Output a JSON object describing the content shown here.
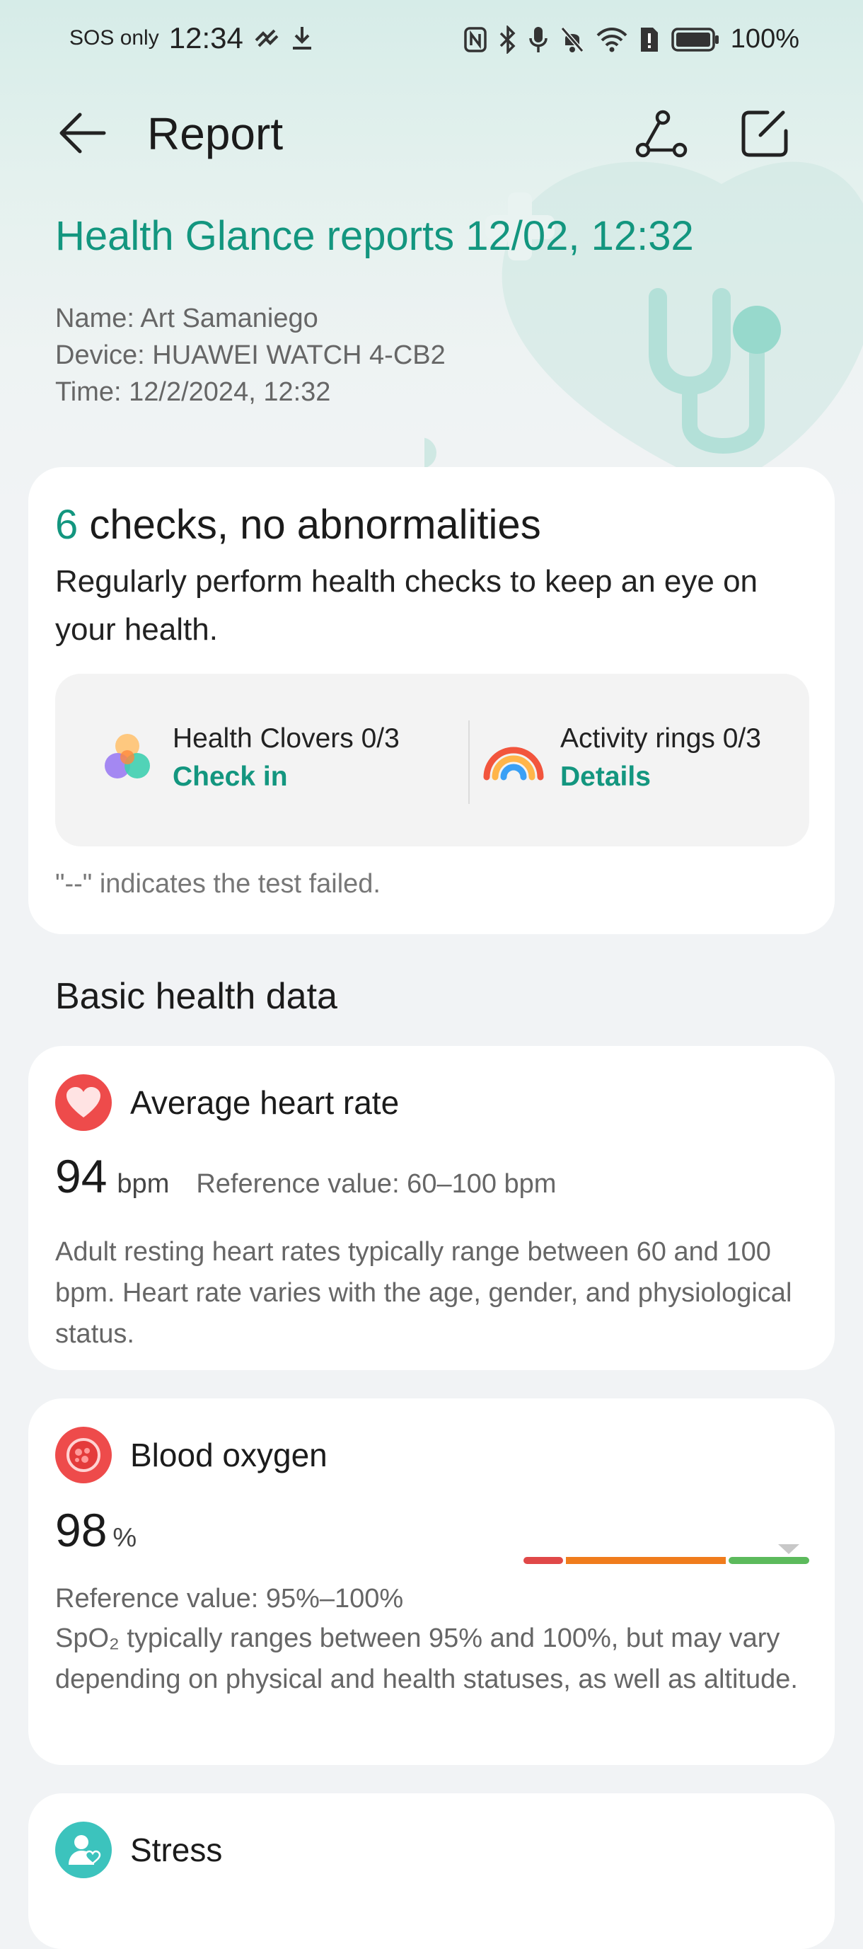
{
  "status_bar": {
    "carrier": "SOS only",
    "time": "12:34",
    "battery": "100%"
  },
  "header": {
    "title": "Report"
  },
  "report": {
    "title": "Health Glance reports 12/02, 12:32",
    "name_line": "Name: Art Samaniego",
    "device_line": "Device: HUAWEI WATCH 4-CB2",
    "time_line": "Time: 12/2/2024, 12:32"
  },
  "summary": {
    "count": "6",
    "headline": " checks, no abnormalities",
    "description": "Regularly perform health checks to keep an eye on your health.",
    "clovers_label": "Health Clovers 0/3",
    "clovers_action": "Check in",
    "rings_label": "Activity rings 0/3",
    "rings_action": "Details",
    "fail_note": "\"--\" indicates the test failed."
  },
  "section": {
    "title": "Basic health data"
  },
  "heart_rate": {
    "name": "Average heart rate",
    "value": "94",
    "unit": "bpm",
    "reference": "Reference value: 60–100 bpm",
    "description": "Adult resting heart rates typically range between 60 and 100 bpm. Heart rate varies with the age, gender, and physiological status."
  },
  "blood_oxygen": {
    "name": "Blood oxygen",
    "value": "98",
    "unit": "%",
    "reference": "Reference value: 95%–100%",
    "description": "SpO₂ typically ranges between 95% and 100%, but may vary depending on physical and health statuses, as well as altitude.",
    "range_colors": [
      "#e04848",
      "#f07c1c",
      "#5cba5c"
    ]
  },
  "stress": {
    "name": "Stress"
  },
  "colors": {
    "accent": "#13967f",
    "heart": "#ee4b4b",
    "stress": "#3cc3bd"
  }
}
